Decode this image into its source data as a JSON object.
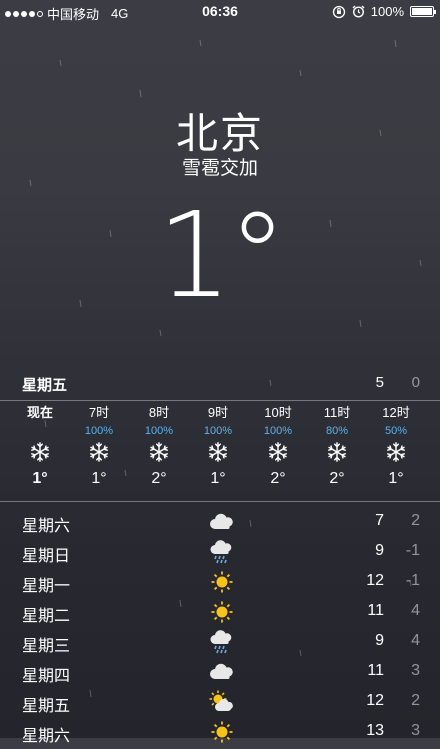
{
  "status": {
    "carrier": "中国移动",
    "network": "4G",
    "time": "06:36",
    "battery": "100%",
    "battery_level": 1.0
  },
  "location": {
    "city": "北京",
    "condition": "雪雹交加",
    "temperature": "1°"
  },
  "today": {
    "day": "星期五",
    "high": "5",
    "low": "0"
  },
  "hourly": [
    {
      "label": "现在",
      "pct": "",
      "icon": "snow-icon",
      "temp": "1°"
    },
    {
      "label": "7时",
      "pct": "100%",
      "icon": "snow-icon",
      "temp": "1°"
    },
    {
      "label": "8时",
      "pct": "100%",
      "icon": "snow-icon",
      "temp": "2°"
    },
    {
      "label": "9时",
      "pct": "100%",
      "icon": "snow-icon",
      "temp": "1°"
    },
    {
      "label": "10时",
      "pct": "100%",
      "icon": "snow-icon",
      "temp": "2°"
    },
    {
      "label": "11时",
      "pct": "80%",
      "icon": "snow-icon",
      "temp": "2°"
    },
    {
      "label": "12时",
      "pct": "50%",
      "icon": "snow-icon",
      "temp": "1°"
    }
  ],
  "daily": [
    {
      "day": "星期六",
      "icon": "cloud-icon",
      "high": "7",
      "low": "2"
    },
    {
      "day": "星期日",
      "icon": "rain-cloud-icon",
      "high": "9",
      "low": "-1"
    },
    {
      "day": "星期一",
      "icon": "sun-icon",
      "high": "12",
      "low": "-1"
    },
    {
      "day": "星期二",
      "icon": "sun-icon",
      "high": "11",
      "low": "4"
    },
    {
      "day": "星期三",
      "icon": "rain-cloud-icon",
      "high": "9",
      "low": "4"
    },
    {
      "day": "星期四",
      "icon": "cloud-icon",
      "high": "11",
      "low": "3"
    },
    {
      "day": "星期五",
      "icon": "partly-cloudy-icon",
      "high": "12",
      "low": "2"
    },
    {
      "day": "星期六",
      "icon": "sun-icon",
      "high": "13",
      "low": "3"
    }
  ],
  "colors": {
    "precip_blue": "#5bb2ee",
    "sun_yellow": "#f7c21a"
  }
}
